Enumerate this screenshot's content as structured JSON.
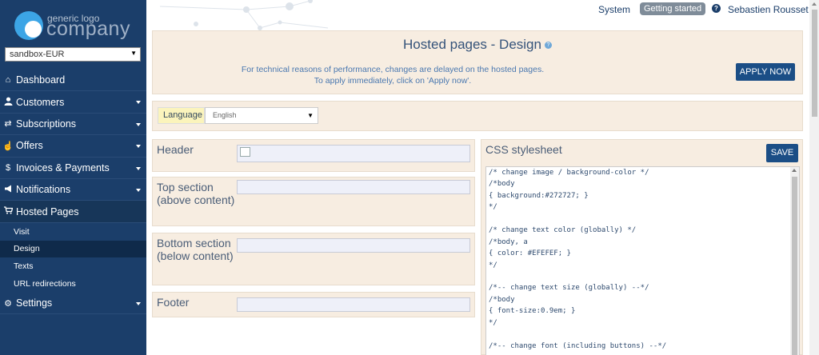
{
  "logo": {
    "small_text": "generic logo",
    "big_text": "company"
  },
  "account_select": {
    "value": "sandbox-EUR"
  },
  "sidebar": {
    "items": [
      {
        "label": "Dashboard",
        "icon": "home-icon"
      },
      {
        "label": "Customers",
        "icon": "user-icon"
      },
      {
        "label": "Subscriptions",
        "icon": "retweet-icon"
      },
      {
        "label": "Offers",
        "icon": "thumbs-up-icon"
      },
      {
        "label": "Invoices & Payments",
        "icon": "dollar-icon"
      },
      {
        "label": "Notifications",
        "icon": "bullhorn-icon"
      },
      {
        "label": "Hosted Pages",
        "icon": "shopping-cart-icon"
      },
      {
        "label": "Settings",
        "icon": "gear-icon"
      }
    ],
    "subitems": [
      "Visit",
      "Design",
      "Texts",
      "URL redirections"
    ]
  },
  "topbar": {
    "system": "System",
    "getting_started": "Getting started",
    "user": "Sebastien Rousset"
  },
  "header": {
    "title": "Hosted pages - Design",
    "notice_line1": "For technical reasons of performance, changes are delayed on the hosted pages.",
    "notice_line2": "To apply immediately, click on 'Apply now'.",
    "apply_label": "APPLY NOW"
  },
  "language": {
    "label": "Language",
    "value": "English"
  },
  "sections": {
    "header": "Header",
    "top": "Top section (above content)",
    "bottom": "Bottom section (below content)",
    "footer": "Footer"
  },
  "css": {
    "title": "CSS stylesheet",
    "save_label": "SAVE",
    "lines": [
      "/* change image / background-color */",
      "/*body",
      "{ background:#272727; }",
      "*/",
      "",
      "/* change text color (globally) */",
      "/*body, a",
      "{ color: #EFEFEF; }",
      "*/",
      "",
      "/*-- change text size (globally) --*/",
      "/*body",
      "{ font-size:0.9em; }",
      "*/",
      "",
      "/*-- change font (including buttons) --*/"
    ]
  },
  "colors": {
    "sidebar_bg": "#1b3e6a",
    "panel_bg": "#f7ede1",
    "button_bg": "#1b4e86",
    "badge_bg": "#7f8c99"
  }
}
